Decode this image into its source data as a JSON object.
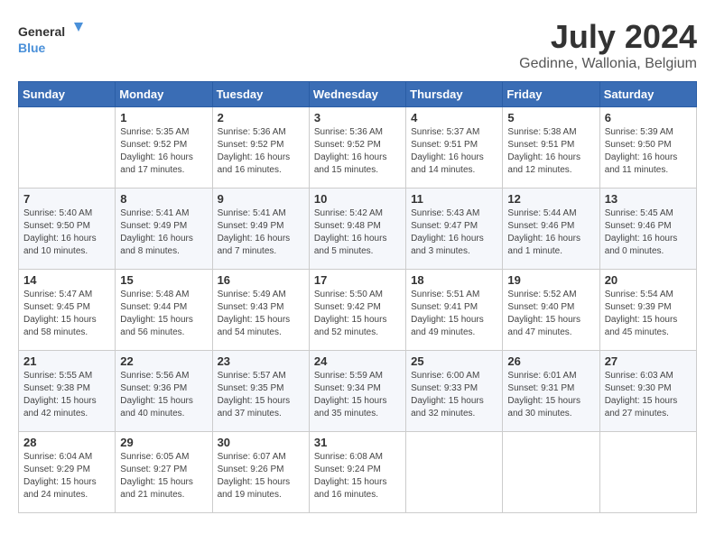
{
  "header": {
    "logo_general": "General",
    "logo_blue": "Blue",
    "month": "July 2024",
    "location": "Gedinne, Wallonia, Belgium"
  },
  "weekdays": [
    "Sunday",
    "Monday",
    "Tuesday",
    "Wednesday",
    "Thursday",
    "Friday",
    "Saturday"
  ],
  "weeks": [
    [
      {
        "day": "",
        "info": ""
      },
      {
        "day": "1",
        "info": "Sunrise: 5:35 AM\nSunset: 9:52 PM\nDaylight: 16 hours\nand 17 minutes."
      },
      {
        "day": "2",
        "info": "Sunrise: 5:36 AM\nSunset: 9:52 PM\nDaylight: 16 hours\nand 16 minutes."
      },
      {
        "day": "3",
        "info": "Sunrise: 5:36 AM\nSunset: 9:52 PM\nDaylight: 16 hours\nand 15 minutes."
      },
      {
        "day": "4",
        "info": "Sunrise: 5:37 AM\nSunset: 9:51 PM\nDaylight: 16 hours\nand 14 minutes."
      },
      {
        "day": "5",
        "info": "Sunrise: 5:38 AM\nSunset: 9:51 PM\nDaylight: 16 hours\nand 12 minutes."
      },
      {
        "day": "6",
        "info": "Sunrise: 5:39 AM\nSunset: 9:50 PM\nDaylight: 16 hours\nand 11 minutes."
      }
    ],
    [
      {
        "day": "7",
        "info": "Sunrise: 5:40 AM\nSunset: 9:50 PM\nDaylight: 16 hours\nand 10 minutes."
      },
      {
        "day": "8",
        "info": "Sunrise: 5:41 AM\nSunset: 9:49 PM\nDaylight: 16 hours\nand 8 minutes."
      },
      {
        "day": "9",
        "info": "Sunrise: 5:41 AM\nSunset: 9:49 PM\nDaylight: 16 hours\nand 7 minutes."
      },
      {
        "day": "10",
        "info": "Sunrise: 5:42 AM\nSunset: 9:48 PM\nDaylight: 16 hours\nand 5 minutes."
      },
      {
        "day": "11",
        "info": "Sunrise: 5:43 AM\nSunset: 9:47 PM\nDaylight: 16 hours\nand 3 minutes."
      },
      {
        "day": "12",
        "info": "Sunrise: 5:44 AM\nSunset: 9:46 PM\nDaylight: 16 hours\nand 1 minute."
      },
      {
        "day": "13",
        "info": "Sunrise: 5:45 AM\nSunset: 9:46 PM\nDaylight: 16 hours\nand 0 minutes."
      }
    ],
    [
      {
        "day": "14",
        "info": "Sunrise: 5:47 AM\nSunset: 9:45 PM\nDaylight: 15 hours\nand 58 minutes."
      },
      {
        "day": "15",
        "info": "Sunrise: 5:48 AM\nSunset: 9:44 PM\nDaylight: 15 hours\nand 56 minutes."
      },
      {
        "day": "16",
        "info": "Sunrise: 5:49 AM\nSunset: 9:43 PM\nDaylight: 15 hours\nand 54 minutes."
      },
      {
        "day": "17",
        "info": "Sunrise: 5:50 AM\nSunset: 9:42 PM\nDaylight: 15 hours\nand 52 minutes."
      },
      {
        "day": "18",
        "info": "Sunrise: 5:51 AM\nSunset: 9:41 PM\nDaylight: 15 hours\nand 49 minutes."
      },
      {
        "day": "19",
        "info": "Sunrise: 5:52 AM\nSunset: 9:40 PM\nDaylight: 15 hours\nand 47 minutes."
      },
      {
        "day": "20",
        "info": "Sunrise: 5:54 AM\nSunset: 9:39 PM\nDaylight: 15 hours\nand 45 minutes."
      }
    ],
    [
      {
        "day": "21",
        "info": "Sunrise: 5:55 AM\nSunset: 9:38 PM\nDaylight: 15 hours\nand 42 minutes."
      },
      {
        "day": "22",
        "info": "Sunrise: 5:56 AM\nSunset: 9:36 PM\nDaylight: 15 hours\nand 40 minutes."
      },
      {
        "day": "23",
        "info": "Sunrise: 5:57 AM\nSunset: 9:35 PM\nDaylight: 15 hours\nand 37 minutes."
      },
      {
        "day": "24",
        "info": "Sunrise: 5:59 AM\nSunset: 9:34 PM\nDaylight: 15 hours\nand 35 minutes."
      },
      {
        "day": "25",
        "info": "Sunrise: 6:00 AM\nSunset: 9:33 PM\nDaylight: 15 hours\nand 32 minutes."
      },
      {
        "day": "26",
        "info": "Sunrise: 6:01 AM\nSunset: 9:31 PM\nDaylight: 15 hours\nand 30 minutes."
      },
      {
        "day": "27",
        "info": "Sunrise: 6:03 AM\nSunset: 9:30 PM\nDaylight: 15 hours\nand 27 minutes."
      }
    ],
    [
      {
        "day": "28",
        "info": "Sunrise: 6:04 AM\nSunset: 9:29 PM\nDaylight: 15 hours\nand 24 minutes."
      },
      {
        "day": "29",
        "info": "Sunrise: 6:05 AM\nSunset: 9:27 PM\nDaylight: 15 hours\nand 21 minutes."
      },
      {
        "day": "30",
        "info": "Sunrise: 6:07 AM\nSunset: 9:26 PM\nDaylight: 15 hours\nand 19 minutes."
      },
      {
        "day": "31",
        "info": "Sunrise: 6:08 AM\nSunset: 9:24 PM\nDaylight: 15 hours\nand 16 minutes."
      },
      {
        "day": "",
        "info": ""
      },
      {
        "day": "",
        "info": ""
      },
      {
        "day": "",
        "info": ""
      }
    ]
  ]
}
